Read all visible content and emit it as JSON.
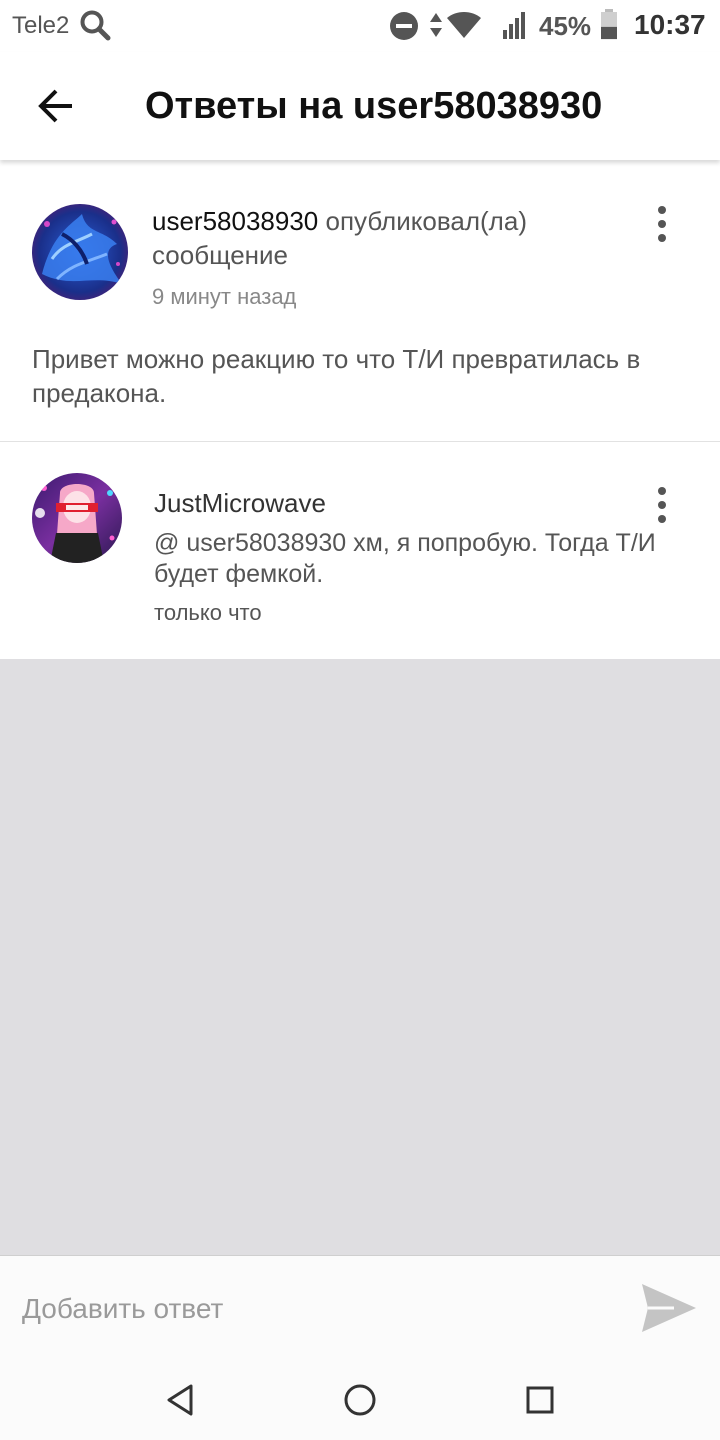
{
  "status_bar": {
    "carrier": "Tele2",
    "battery_percent": "45%",
    "battery_level": 0.45,
    "time": "10:37",
    "icons": [
      "search-icon",
      "do-not-disturb-icon",
      "data-arrows-icon",
      "wifi-icon",
      "signal-icon",
      "battery-icon"
    ]
  },
  "app_bar": {
    "title": "Ответы на user58038930",
    "back_icon": "arrow-left-icon"
  },
  "post": {
    "author": "user58038930",
    "action": "опубликовал(ла) сообщение",
    "time": "9 минут назад",
    "body": "Привет можно реакцию то что Т/И превратилась в предакона.",
    "menu_icon": "more-vert-icon"
  },
  "reply": {
    "author": "JustMicrowave",
    "text": "@ user58038930  хм, я попробую. Тогда Т/И будет фемкой.",
    "time": "только что",
    "menu_icon": "more-vert-icon"
  },
  "reply_input": {
    "placeholder": "Добавить ответ",
    "send_icon": "send-icon"
  },
  "nav_bar": {
    "icons": [
      "nav-back-icon",
      "nav-home-icon",
      "nav-recents-icon"
    ]
  },
  "colors": {
    "background": "#ffffff",
    "empty_area": "#dfdee1",
    "text_primary": "#111111",
    "text_secondary": "#555555",
    "text_muted": "#888888",
    "send_icon": "#c4c4c4"
  }
}
